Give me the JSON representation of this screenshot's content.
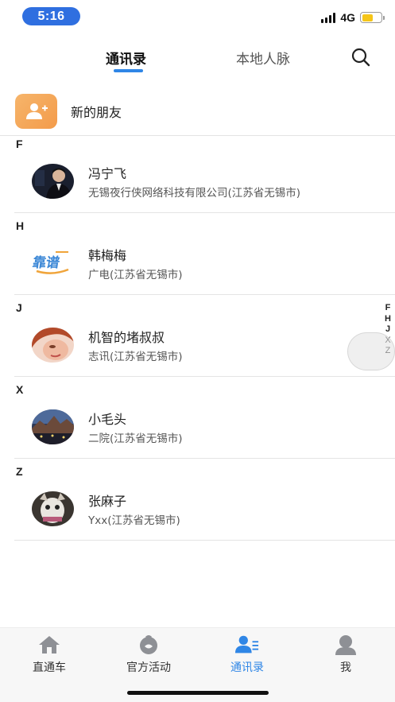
{
  "status_bar": {
    "time": "5:16",
    "network": "4G",
    "time_color": "#2f6fe0",
    "battery_level": 0.6
  },
  "top_tabs": {
    "contacts": "通讯录",
    "local": "本地人脉",
    "active": "contacts",
    "accent": "#2f86e6"
  },
  "new_friends": {
    "label": "新的朋友",
    "icon": "add-user-icon"
  },
  "sections": [
    {
      "letter": "F",
      "contacts": [
        {
          "name": "冯宁飞",
          "sub": "无锡夜行侠网络科技有限公司(江苏省无锡市)"
        }
      ]
    },
    {
      "letter": "H",
      "contacts": [
        {
          "name": "韩梅梅",
          "sub": "广电(江苏省无锡市)",
          "logo_text": "靠谱"
        }
      ]
    },
    {
      "letter": "J",
      "contacts": [
        {
          "name": "机智的堵叔叔",
          "sub": "志讯(江苏省无锡市)"
        }
      ]
    },
    {
      "letter": "X",
      "contacts": [
        {
          "name": "小毛头",
          "sub": "二院(江苏省无锡市)"
        }
      ]
    },
    {
      "letter": "Z",
      "contacts": [
        {
          "name": "张麻子",
          "sub": "Yxx(江苏省无锡市)"
        }
      ]
    }
  ],
  "index_bar": [
    "F",
    "H",
    "J",
    "X",
    "Z"
  ],
  "bottom_nav": [
    {
      "label": "直通车",
      "icon": "home-icon"
    },
    {
      "label": "官方活动",
      "icon": "activity-icon"
    },
    {
      "label": "通讯录",
      "icon": "contacts-icon",
      "active": true
    },
    {
      "label": "我",
      "icon": "profile-icon"
    }
  ]
}
